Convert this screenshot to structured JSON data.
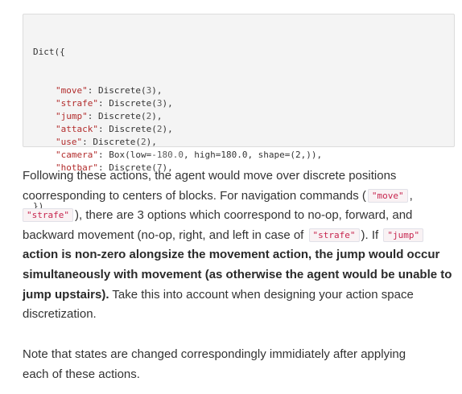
{
  "code": {
    "open": "Dict({",
    "entries": [
      {
        "key": "\"move\"",
        "sep": ": ",
        "call": "Discrete(",
        "arg": "3",
        "close": "),"
      },
      {
        "key": "\"strafe\"",
        "sep": ": ",
        "call": "Discrete(",
        "arg": "3",
        "close": "),"
      },
      {
        "key": "\"jump\"",
        "sep": ": ",
        "call": "Discrete(",
        "arg": "2",
        "close": "),"
      },
      {
        "key": "\"attack\"",
        "sep": ": ",
        "call": "Discrete(",
        "arg": "2",
        "close": "),"
      },
      {
        "key": "\"use\"",
        "sep": ": ",
        "call": "Discrete(",
        "arg": "2",
        "close": "),"
      },
      {
        "key": "\"camera\"",
        "sep": ": ",
        "call": "Box(low=",
        "arg": "-180.0",
        "close": ", high=180.0, shape=(2,)),"
      },
      {
        "key": "\"hotbar\"",
        "sep": ": ",
        "call": "Discrete(",
        "arg": "7",
        "close": "),"
      }
    ],
    "end": "})"
  },
  "paragraph1": {
    "l1": "Following these actions, the agent would move over discrete positions",
    "l2_text": "coorresponding to centers of blocks. For navigation commands (",
    "l2_code": "\"move\"",
    "l2_tail": ",",
    "l3_code": "\"strafe\"",
    "l3_text": "), there are 3 options which coorrespond to no-op, forward, and",
    "l4_text": "backward movement (no-op, right, and left in case of",
    "l4_code1": "\"strafe\"",
    "l4_mid": "). If",
    "l4_code2": "\"jump\"",
    "l5_bold": "action is non-zero alongsize the movement action, the jump would occur",
    "l6_bold": "simultaneously with movement (as otherwise the agent would be unable to",
    "l7_bold": "jump upstairs).",
    "l7_text": " Take this into account when designing your action space",
    "l8_text": "discretization."
  },
  "paragraph2": {
    "l1": "Note that states are changed correspondingly immidiately after applying",
    "l2": "each of these actions."
  }
}
